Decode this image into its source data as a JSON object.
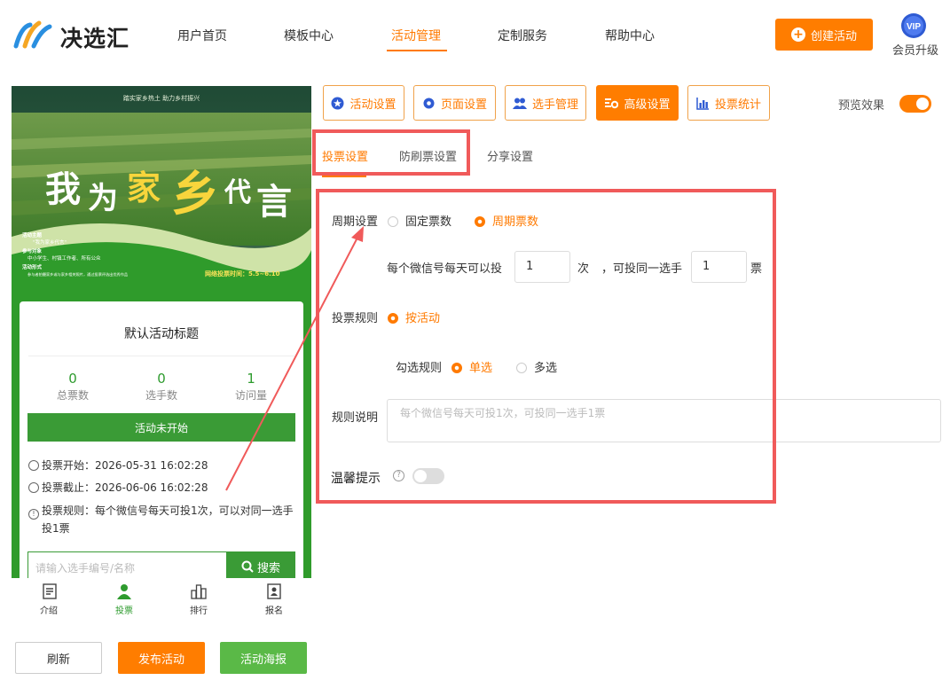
{
  "header": {
    "logo_text": "决选汇",
    "nav": [
      "用户首页",
      "模板中心",
      "活动管理",
      "定制服务",
      "帮助中心"
    ],
    "active_nav": "活动管理",
    "create_button": "创建活动",
    "vip_badge": "VIP",
    "vip_label": "会员升级"
  },
  "poster": {
    "top_slogan": "踏实家乡热土    助力乡村振兴",
    "title_chars": [
      "我",
      "为",
      "家",
      "乡",
      "代",
      "言"
    ],
    "theme_heading": "活动主题",
    "theme_text": "\"我为家乡代言\"",
    "join_heading": "参与对象",
    "join_text": "中小学生、村镇工作者、所有公众",
    "form_heading": "活动形式",
    "form_text": "参与者拍摄家乡或与家乡相关照片，通过投票评选出优秀作品",
    "vote_time": "网络投票时间：5.5~6.10"
  },
  "card": {
    "title": "默认活动标题",
    "stats": [
      {
        "num": "0",
        "label": "总票数"
      },
      {
        "num": "0",
        "label": "选手数"
      },
      {
        "num": "1",
        "label": "访问量"
      }
    ],
    "status_button": "活动未开始",
    "vote_start": "投票开始：2026-05-31 16:02:28",
    "vote_end": "投票截止：2026-06-06 16:02:28",
    "vote_rule": "投票规则：每个微信号每天可投1次，可以对同一选手投1票",
    "search_placeholder": "请输入选手编号/名称",
    "search_button": "搜索"
  },
  "tabbar": [
    {
      "label": "介绍",
      "active": false
    },
    {
      "label": "投票",
      "active": true
    },
    {
      "label": "排行",
      "active": false
    },
    {
      "label": "报名",
      "active": false
    }
  ],
  "bottom_buttons": {
    "refresh": "刷新",
    "publish": "发布活动",
    "poster": "活动海报"
  },
  "toolbar": {
    "activity_settings": "活动设置",
    "page_settings": "页面设置",
    "player_management": "选手管理",
    "advanced_settings": "高级设置",
    "vote_stats": "投票统计",
    "preview_label": "预览效果"
  },
  "subtabs": [
    "投票设置",
    "防刷票设置",
    "分享设置"
  ],
  "form": {
    "cycle_label": "周期设置",
    "fixed_votes": "固定票数",
    "cycle_votes": "周期票数",
    "per_day_text": "每个微信号每天可以投",
    "per_day_value": "1",
    "times_unit": "次",
    "same_player_text": "，可投同一选手",
    "same_player_value": "1",
    "votes_unit": "票",
    "rule_label": "投票规则",
    "by_activity": "按活动",
    "select_rule_label": "勾选规则",
    "single": "单选",
    "multi": "多选",
    "desc_label": "规则说明",
    "desc_placeholder": "每个微信号每天可投1次，可投同一选手1票",
    "tip_label": "温馨提示"
  },
  "colors": {
    "accent": "#ff7d00",
    "green": "#3a9b36",
    "highlight_red": "#f05a5a"
  }
}
